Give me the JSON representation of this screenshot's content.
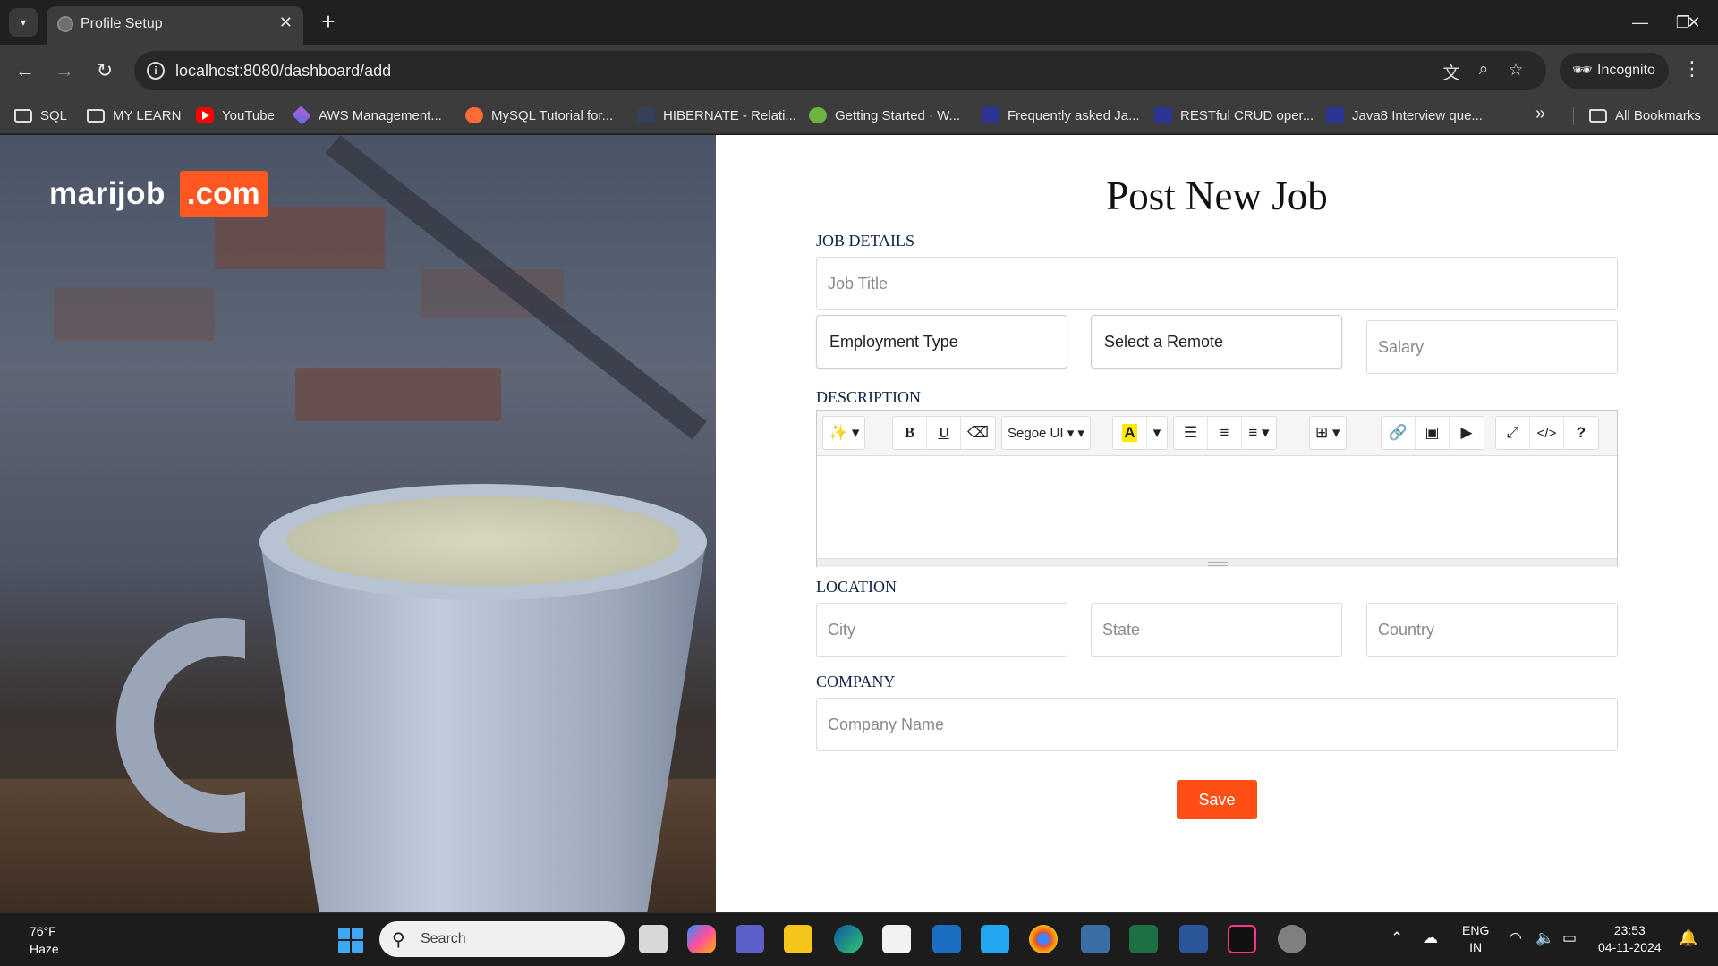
{
  "browser": {
    "tab_title": "Profile Setup",
    "url": "localhost:8080/dashboard/add",
    "incognito_label": "Incognito",
    "bookmarks": [
      {
        "label": "SQL",
        "icon": "folder-icon"
      },
      {
        "label": "MY LEARN",
        "icon": "folder-icon"
      },
      {
        "label": "YouTube",
        "icon": "youtube-icon"
      },
      {
        "label": "AWS Management...",
        "icon": "aws-icon"
      },
      {
        "label": "MySQL Tutorial for...",
        "icon": "mysql-icon"
      },
      {
        "label": "HIBERNATE - Relati...",
        "icon": "hibernate-icon"
      },
      {
        "label": "Getting Started · W...",
        "icon": "spring-icon"
      },
      {
        "label": "Frequently asked Ja...",
        "icon": "blog-icon"
      },
      {
        "label": "RESTful CRUD oper...",
        "icon": "blog-icon"
      },
      {
        "label": "Java8 Interview que...",
        "icon": "blog-icon"
      }
    ],
    "all_bookmarks_label": "All Bookmarks"
  },
  "brand": {
    "name_part": "marijob",
    "tld_part": ".com",
    "accent": "#ff5722"
  },
  "form": {
    "title": "Post New Job",
    "sections": {
      "job_details": "JOB DETAILS",
      "description": "DESCRIPTION",
      "location": "LOCATION",
      "company": "COMPANY"
    },
    "fields": {
      "job_title_placeholder": "Job Title",
      "employment_type": "Employment Type",
      "remote": "Select a Remote",
      "salary_placeholder": "Salary",
      "city_placeholder": "City",
      "state_placeholder": "State",
      "country_placeholder": "Country",
      "company_placeholder": "Company Name"
    },
    "editor": {
      "font_name": "Segoe UI",
      "code_view_label": "</>",
      "help_label": "?"
    },
    "save_label": "Save",
    "save_color": "#ff4f14"
  },
  "taskbar": {
    "temperature": "76°F",
    "condition": "Haze",
    "search_label": "Search",
    "language": "ENG",
    "region": "IN",
    "time": "23:53",
    "date": "04-11-2024"
  }
}
